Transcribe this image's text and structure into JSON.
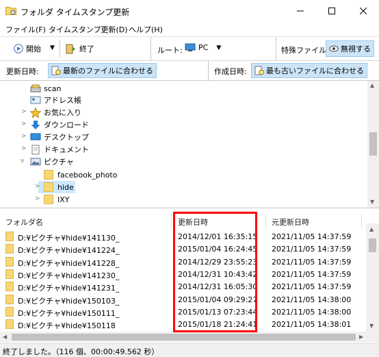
{
  "window": {
    "title": "フォルダ タイムスタンプ更新"
  },
  "menu": [
    "ファイル(F)",
    "タイムスタンプ更新(D)",
    "ヘルプ(H)"
  ],
  "toolbar": {
    "start_label": "開始",
    "end_label": "終了",
    "root_label": "ルート:",
    "root_value": "PC",
    "special_label": "特殊ファイル:",
    "ignore_label": "無視する",
    "modified_label": "更新日時:",
    "modified_value": "最新のファイルに合わせる",
    "created_label": "作成日時:",
    "created_value": "最も古いファイルに合わせる"
  },
  "tree": {
    "items": [
      "scan",
      "アドレス帳",
      "お気に入り",
      "ダウンロード",
      "デスクトップ",
      "ドキュメント",
      "ピクチャ",
      "facebook_photo",
      "hide",
      "IXY"
    ],
    "selected": "hide"
  },
  "list": {
    "columns": [
      "フォルダ名",
      "更新日時",
      "元更新日時"
    ],
    "rows": [
      [
        "D:¥ピクチャ¥hide¥141130_",
        "2014/12/01 16:35:15",
        "2021/11/05 14:37:59"
      ],
      [
        "D:¥ピクチャ¥hide¥141224_",
        "2015/01/04 16:24:45",
        "2021/11/05 14:37:59"
      ],
      [
        "D:¥ピクチャ¥hide¥141228_",
        "2014/12/29 23:55:23",
        "2021/11/05 14:37:59"
      ],
      [
        "D:¥ピクチャ¥hide¥141230_",
        "2014/12/31 10:43:42",
        "2021/11/05 14:37:59"
      ],
      [
        "D:¥ピクチャ¥hide¥141231_",
        "2014/12/31 16:05:30",
        "2021/11/05 14:37:59"
      ],
      [
        "D:¥ピクチャ¥hide¥150103_",
        "2015/01/04 09:29:27",
        "2021/11/05 14:38:00"
      ],
      [
        "D:¥ピクチャ¥hide¥150111_",
        "2015/01/13 07:23:44",
        "2021/11/05 14:38:00"
      ],
      [
        "D:¥ピクチャ¥hide¥150118",
        "2015/01/18 21:24:41",
        "2021/11/05 14:38:01"
      ]
    ]
  },
  "status": "終了しました。（116 個、00:00:49.562 秒）"
}
